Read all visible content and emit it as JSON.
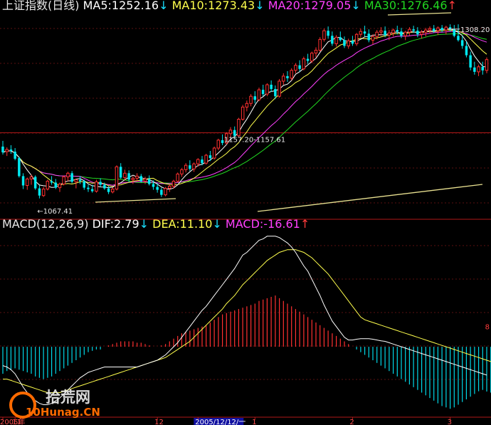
{
  "chart_data": [
    {
      "type": "candlestick",
      "title": "上证指数(日线)",
      "legend": [
        {
          "label": "MA5:",
          "value": "1252.16",
          "arrow": "↓",
          "color": "#ffffff",
          "arrow_color": "#19e0ff"
        },
        {
          "label": "MA10:",
          "value": "1273.43",
          "arrow": "↓",
          "color": "#ffff4d",
          "arrow_color": "#19e0ff"
        },
        {
          "label": "MA20:",
          "value": "1279.05",
          "arrow": "↓",
          "color": "#ff40ff",
          "arrow_color": "#19e0ff"
        },
        {
          "label": "MA30:",
          "value": "1276.46",
          "arrow": "↑",
          "color": "#21d721",
          "arrow_color": "#ff3b3b"
        }
      ],
      "ylim": [
        1040,
        1320
      ],
      "right_axis_ticks": [],
      "reference_level": 1157.2,
      "annotations": {
        "low_label": "←1067.41",
        "low_value": 1067.41,
        "low_index": 9,
        "mid_label": "1157.20-1157.61",
        "mid_index": 53,
        "high_label": "1308.20",
        "high_value": 1308.2,
        "high_index": 112
      },
      "candles": [
        [
          1138,
          1146,
          1127,
          1130
        ],
        [
          1131,
          1137,
          1125,
          1134
        ],
        [
          1134,
          1140,
          1128,
          1132
        ],
        [
          1131,
          1136,
          1119,
          1121
        ],
        [
          1122,
          1124,
          1095,
          1097
        ],
        [
          1097,
          1101,
          1079,
          1084
        ],
        [
          1084,
          1095,
          1078,
          1093
        ],
        [
          1093,
          1099,
          1085,
          1096
        ],
        [
          1096,
          1098,
          1078,
          1080
        ],
        [
          1080,
          1084,
          1066,
          1070
        ],
        [
          1070,
          1082,
          1068,
          1079
        ],
        [
          1079,
          1092,
          1077,
          1090
        ],
        [
          1090,
          1097,
          1085,
          1088
        ],
        [
          1088,
          1093,
          1079,
          1081
        ],
        [
          1081,
          1088,
          1075,
          1086
        ],
        [
          1086,
          1098,
          1084,
          1096
        ],
        [
          1096,
          1103,
          1090,
          1101
        ],
        [
          1101,
          1104,
          1087,
          1089
        ],
        [
          1089,
          1093,
          1080,
          1092
        ],
        [
          1092,
          1097,
          1086,
          1090
        ],
        [
          1090,
          1092,
          1078,
          1081
        ],
        [
          1081,
          1085,
          1075,
          1079
        ],
        [
          1079,
          1085,
          1074,
          1076
        ],
        [
          1076,
          1092,
          1074,
          1089
        ],
        [
          1089,
          1094,
          1082,
          1085
        ],
        [
          1085,
          1088,
          1078,
          1080
        ],
        [
          1080,
          1083,
          1072,
          1075
        ],
        [
          1075,
          1081,
          1073,
          1079
        ],
        [
          1079,
          1112,
          1077,
          1110
        ],
        [
          1110,
          1115,
          1093,
          1095
        ],
        [
          1095,
          1106,
          1091,
          1101
        ],
        [
          1101,
          1105,
          1089,
          1092
        ],
        [
          1092,
          1097,
          1086,
          1094
        ],
        [
          1094,
          1101,
          1090,
          1097
        ],
        [
          1097,
          1100,
          1088,
          1090
        ],
        [
          1090,
          1096,
          1086,
          1093
        ],
        [
          1093,
          1098,
          1084,
          1086
        ],
        [
          1086,
          1091,
          1078,
          1082
        ],
        [
          1082,
          1087,
          1074,
          1078
        ],
        [
          1078,
          1081,
          1068,
          1071
        ],
        [
          1071,
          1082,
          1069,
          1080
        ],
        [
          1080,
          1085,
          1075,
          1083
        ],
        [
          1083,
          1092,
          1080,
          1090
        ],
        [
          1090,
          1102,
          1088,
          1100
        ],
        [
          1100,
          1108,
          1096,
          1106
        ],
        [
          1106,
          1115,
          1102,
          1112
        ],
        [
          1112,
          1119,
          1104,
          1107
        ],
        [
          1107,
          1116,
          1103,
          1114
        ],
        [
          1114,
          1122,
          1110,
          1120
        ],
        [
          1120,
          1125,
          1112,
          1115
        ],
        [
          1115,
          1128,
          1113,
          1126
        ],
        [
          1126,
          1132,
          1118,
          1122
        ],
        [
          1122,
          1138,
          1120,
          1136
        ],
        [
          1136,
          1149,
          1133,
          1147
        ],
        [
          1147,
          1155,
          1140,
          1143
        ],
        [
          1143,
          1158,
          1141,
          1156
        ],
        [
          1156,
          1165,
          1151,
          1161
        ],
        [
          1161,
          1166,
          1150,
          1153
        ],
        [
          1153,
          1178,
          1151,
          1176
        ],
        [
          1176,
          1196,
          1174,
          1193
        ],
        [
          1193,
          1202,
          1187,
          1198
        ],
        [
          1198,
          1211,
          1194,
          1208
        ],
        [
          1208,
          1215,
          1198,
          1203
        ],
        [
          1203,
          1220,
          1201,
          1217
        ],
        [
          1217,
          1224,
          1208,
          1211
        ],
        [
          1211,
          1226,
          1208,
          1224
        ],
        [
          1224,
          1230,
          1214,
          1218
        ],
        [
          1218,
          1223,
          1204,
          1208
        ],
        [
          1208,
          1232,
          1206,
          1229
        ],
        [
          1229,
          1240,
          1224,
          1236
        ],
        [
          1236,
          1243,
          1228,
          1233
        ],
        [
          1233,
          1247,
          1230,
          1244
        ],
        [
          1244,
          1254,
          1240,
          1251
        ],
        [
          1251,
          1258,
          1242,
          1246
        ],
        [
          1246,
          1263,
          1244,
          1260
        ],
        [
          1260,
          1267,
          1253,
          1257
        ],
        [
          1257,
          1270,
          1254,
          1268
        ],
        [
          1268,
          1276,
          1262,
          1272
        ],
        [
          1272,
          1290,
          1270,
          1287
        ],
        [
          1287,
          1302,
          1284,
          1299
        ],
        [
          1299,
          1305,
          1288,
          1292
        ],
        [
          1292,
          1298,
          1278,
          1281
        ],
        [
          1281,
          1293,
          1277,
          1290
        ],
        [
          1290,
          1298,
          1284,
          1286
        ],
        [
          1286,
          1291,
          1275,
          1278
        ],
        [
          1278,
          1288,
          1274,
          1285
        ],
        [
          1285,
          1292,
          1278,
          1281
        ],
        [
          1281,
          1296,
          1278,
          1294
        ],
        [
          1294,
          1302,
          1290,
          1298
        ],
        [
          1298,
          1306,
          1291,
          1295
        ],
        [
          1295,
          1301,
          1283,
          1286
        ],
        [
          1286,
          1294,
          1280,
          1291
        ],
        [
          1291,
          1300,
          1287,
          1297
        ],
        [
          1297,
          1304,
          1292,
          1299
        ],
        [
          1299,
          1305,
          1290,
          1293
        ],
        [
          1293,
          1300,
          1286,
          1296
        ],
        [
          1296,
          1302,
          1291,
          1300
        ],
        [
          1300,
          1306,
          1294,
          1298
        ],
        [
          1298,
          1303,
          1289,
          1292
        ],
        [
          1292,
          1299,
          1286,
          1297
        ],
        [
          1297,
          1304,
          1292,
          1301
        ],
        [
          1301,
          1306,
          1296,
          1299
        ],
        [
          1299,
          1304,
          1290,
          1294
        ],
        [
          1294,
          1300,
          1288,
          1297
        ],
        [
          1297,
          1303,
          1291,
          1300
        ],
        [
          1300,
          1305,
          1295,
          1302
        ],
        [
          1302,
          1307,
          1296,
          1299
        ],
        [
          1299,
          1305,
          1293,
          1303
        ],
        [
          1303,
          1307,
          1297,
          1300
        ],
        [
          1300,
          1306,
          1294,
          1304
        ],
        [
          1304,
          1308,
          1298,
          1301
        ],
        [
          1301,
          1307,
          1290,
          1292
        ],
        [
          1292,
          1308,
          1284,
          1286
        ],
        [
          1286,
          1292,
          1274,
          1278
        ],
        [
          1278,
          1284,
          1262,
          1265
        ],
        [
          1265,
          1270,
          1244,
          1248
        ],
        [
          1248,
          1256,
          1238,
          1242
        ],
        [
          1242,
          1252,
          1236,
          1249
        ],
        [
          1249,
          1256,
          1238,
          1244
        ],
        [
          1244,
          1262,
          1240,
          1259
        ]
      ]
    },
    {
      "type": "macd",
      "title": "MACD(12,26,9)",
      "legend": [
        {
          "label": "DIF:",
          "value": "2.79",
          "arrow": "↓",
          "color": "#ffffff",
          "arrow_color": "#19e0ff"
        },
        {
          "label": "DEA:",
          "value": "11.10",
          "arrow": "↓",
          "color": "#ffff4d",
          "arrow_color": "#19e0ff"
        },
        {
          "label": "MACD:",
          "value": "-16.61",
          "arrow": "↑",
          "color": "#ff40ff",
          "arrow_color": "#ff3b3b"
        }
      ],
      "ylim": [
        -24,
        42
      ],
      "right_axis_ticks": [
        {
          "value": 7.5,
          "label": "8"
        }
      ],
      "dif": [
        -7,
        -7.5,
        -8.5,
        -10,
        -12.5,
        -15,
        -17,
        -18.5,
        -20,
        -21,
        -21.5,
        -21.5,
        -21,
        -20,
        -19,
        -17.5,
        -16,
        -14.5,
        -13,
        -11.5,
        -10.5,
        -9.5,
        -9,
        -8.5,
        -8,
        -7.5,
        -7.5,
        -7.5,
        -7.5,
        -7.5,
        -7.5,
        -7.5,
        -7.5,
        -7.5,
        -7,
        -6.5,
        -6,
        -5.5,
        -5,
        -4,
        -3,
        -1.5,
        0,
        1.5,
        3.5,
        5.5,
        7.5,
        9.5,
        11.5,
        13.5,
        15,
        17,
        19,
        21,
        23,
        25,
        27,
        29,
        31.5,
        34,
        35,
        36.5,
        38,
        39.5,
        40,
        41,
        41,
        41,
        40.5,
        39.5,
        38.5,
        37,
        35,
        32.5,
        30,
        28,
        25,
        22,
        19,
        15.5,
        12.5,
        9.5,
        7.5,
        5.5,
        3.5,
        2.5,
        2.5,
        2.8,
        3,
        3,
        3,
        2.8,
        2.5,
        2.2,
        2,
        1.5,
        1,
        0.5,
        0,
        -0.5,
        -1,
        -1.5,
        -2,
        -2.5,
        -3,
        -3.5,
        -4,
        -4.5,
        -5,
        -5.5,
        -6,
        -6.5,
        -7,
        -7.5,
        -8,
        -8.5,
        -9,
        -9.5,
        -10,
        -10.5
      ],
      "dea": [
        -12,
        -12,
        -12.5,
        -13,
        -13.5,
        -14,
        -14.5,
        -15,
        -15.5,
        -16,
        -16.5,
        -17,
        -17,
        -17,
        -17,
        -16.5,
        -16,
        -15.5,
        -15,
        -14.5,
        -14,
        -13.5,
        -13,
        -12.5,
        -12,
        -11.5,
        -11,
        -10.5,
        -10,
        -9.5,
        -9,
        -8.5,
        -8,
        -7.5,
        -7,
        -6.5,
        -6,
        -5.5,
        -5,
        -4.5,
        -4,
        -3,
        -2,
        -1,
        0,
        1,
        2,
        3.5,
        5,
        6.5,
        8,
        9.5,
        11,
        12.5,
        14,
        16,
        17.5,
        19,
        21,
        23,
        24.5,
        26,
        27.5,
        29,
        30.5,
        32,
        33,
        34,
        35,
        35.5,
        36,
        36,
        36,
        35.5,
        35,
        34,
        33,
        31.5,
        30,
        28.5,
        27,
        25,
        23,
        21,
        19,
        17,
        15,
        13,
        11,
        10,
        9.5,
        9,
        8.5,
        8,
        7.5,
        7,
        6.5,
        6,
        5.5,
        5,
        4.5,
        4,
        3.5,
        3,
        2.5,
        2,
        1.5,
        1,
        0.5,
        0,
        -0.5,
        -1,
        -1.5,
        -2,
        -2.5,
        -3,
        -3.5,
        -4,
        -4.5,
        -5,
        -5.5,
        -6
      ],
      "macd": [
        -10,
        -9,
        -8.5,
        -8,
        -8.5,
        -9,
        -9.5,
        -10,
        -11,
        -11.5,
        -12,
        -11.5,
        -11,
        -10,
        -9,
        -8,
        -7,
        -6,
        -5,
        -4,
        -3,
        -2,
        -1.5,
        -1,
        -1,
        0,
        0.5,
        1,
        1.5,
        2,
        2,
        2,
        2,
        1.5,
        1.5,
        1,
        0.5,
        0,
        0,
        0.5,
        1,
        2,
        3,
        4,
        5,
        5.5,
        6,
        6.5,
        7,
        7.5,
        8,
        9,
        10,
        11,
        12,
        12.5,
        13,
        13.5,
        14,
        14.5,
        15,
        15.5,
        16,
        17,
        17.5,
        18,
        18.5,
        19,
        18,
        17,
        16,
        15,
        14,
        13,
        12,
        11,
        10,
        9,
        8,
        7,
        6,
        5,
        4,
        3,
        2,
        1,
        0,
        -1,
        -2,
        -3,
        -4,
        -5,
        -6,
        -7,
        -8,
        -9,
        -10,
        -11,
        -12,
        -13,
        -14,
        -15,
        -16,
        -17,
        -18,
        -19,
        -20,
        -21,
        -22,
        -22.5,
        -23,
        -22.5,
        -21.5,
        -20.5,
        -19.5,
        -18.5,
        -17.5,
        -16.5,
        -16,
        -16.61,
        -17,
        -17.5
      ]
    }
  ],
  "time_axis": {
    "labels": [
      {
        "text": "2005年",
        "index": 0
      },
      {
        "text": "11",
        "index": 3
      },
      {
        "text": "12",
        "index": 38
      },
      {
        "text": "2005/12/12/一",
        "index": 48
      },
      {
        "text": "1",
        "index": 62
      },
      {
        "text": "2",
        "index": 86
      },
      {
        "text": "3",
        "index": 110
      }
    ]
  },
  "watermark": {
    "line1": "拾荒网",
    "line2": "10Hunag.CN"
  }
}
